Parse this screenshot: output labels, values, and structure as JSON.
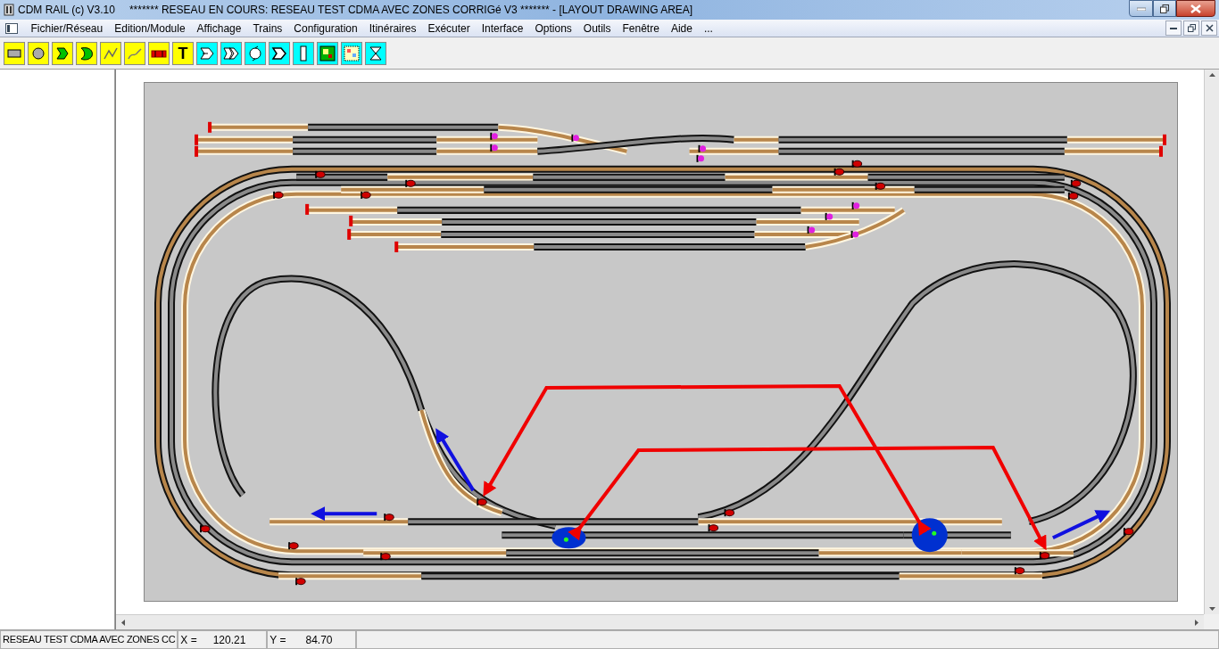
{
  "window": {
    "app_title": "CDM RAIL (c) V3.10",
    "title": "******* RESEAU EN COURS: RESEAU TEST CDMA AVEC ZONES CORRIGé V3 ******* - [LAYOUT DRAWING AREA]"
  },
  "menu": [
    "Fichier/Réseau",
    "Edition/Module",
    "Affichage",
    "Trains",
    "Configuration",
    "Itinéraires",
    "Exécuter",
    "Interface",
    "Options",
    "Outils",
    "Fenêtre",
    "Aide",
    "..."
  ],
  "toolbar": [
    {
      "kind": "rectangle"
    },
    {
      "kind": "circle"
    },
    {
      "kind": "curve"
    },
    {
      "kind": "curve-round"
    },
    {
      "kind": "line"
    },
    {
      "kind": "line-soft"
    },
    {
      "kind": "wagon"
    },
    {
      "kind": "text",
      "label": "T"
    },
    {
      "kind": "switch-arrow"
    },
    {
      "kind": "switch-double"
    },
    {
      "kind": "loop"
    },
    {
      "kind": "switch-out"
    },
    {
      "kind": "block"
    },
    {
      "kind": "station"
    },
    {
      "kind": "grid"
    },
    {
      "kind": "cross"
    }
  ],
  "status_bar": {
    "network": "RESEAU TEST CDMA AVEC ZONES CC",
    "x_label": "X =",
    "x_value": "120.21",
    "y_label": "Y =",
    "y_value": "84.70"
  }
}
